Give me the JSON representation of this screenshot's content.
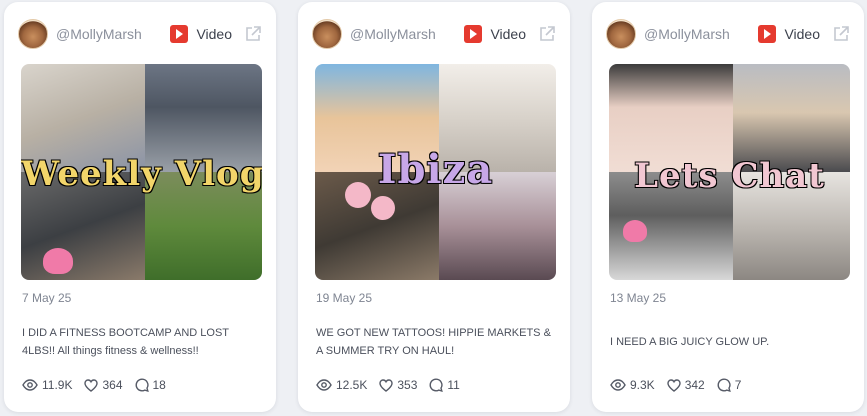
{
  "cards": [
    {
      "author": "@MollyMarsh",
      "type_label": "Video",
      "thumbnail_text": "Weekly Vlog",
      "date": "7 May 25",
      "caption": "I DID A FITNESS BOOTCAMP AND LOST 4LBS!! All things fitness & wellness!!",
      "views": "11.9K",
      "likes": "364",
      "comments": "18"
    },
    {
      "author": "@MollyMarsh",
      "type_label": "Video",
      "thumbnail_text": "Ibiza",
      "date": "19 May 25",
      "caption": "WE GOT NEW TATTOOS! HIPPIE MARKETS & A SUMMER TRY ON HAUL!",
      "views": "12.5K",
      "likes": "353",
      "comments": "11"
    },
    {
      "author": "@MollyMarsh",
      "type_label": "Video",
      "thumbnail_text": "Lets Chat",
      "date": "13 May 25",
      "caption": "I NEED A BIG JUICY GLOW UP.",
      "views": "9.3K",
      "likes": "342",
      "comments": "7"
    }
  ],
  "icons": {
    "platform": "youtube-icon",
    "open": "external-link-icon",
    "views": "eye-icon",
    "likes": "heart-icon",
    "comments": "comment-icon"
  },
  "colors": {
    "youtube_red": "#e53a2f",
    "card_bg": "#ffffff",
    "page_bg": "#eef0f4"
  }
}
